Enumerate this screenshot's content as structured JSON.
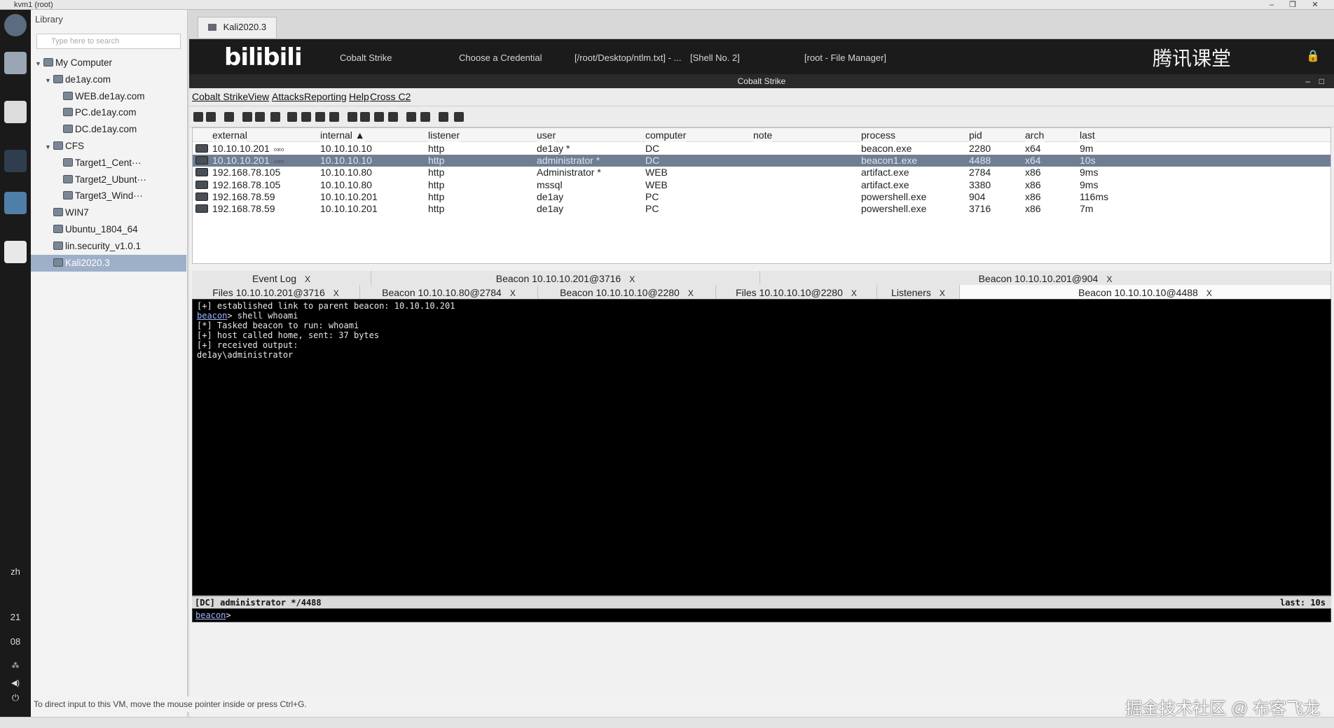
{
  "host": {
    "title": "kvm1 (root)",
    "status_text": "To direct input to this VM, move the mouse pointer inside or press Ctrl+G.",
    "watermark": "掘金技术社区 @ 布客飞龙"
  },
  "library": {
    "title": "Library",
    "search_placeholder": "Type here to search",
    "tree": [
      {
        "label": "My Computer",
        "indent": 0,
        "expanded": true
      },
      {
        "label": "de1ay.com",
        "indent": 1,
        "expanded": true
      },
      {
        "label": "WEB.de1ay.com",
        "indent": 2
      },
      {
        "label": "PC.de1ay.com",
        "indent": 2
      },
      {
        "label": "DC.de1ay.com",
        "indent": 2
      },
      {
        "label": "CFS",
        "indent": 1,
        "expanded": true
      },
      {
        "label": "Target1_Cent···",
        "indent": 2
      },
      {
        "label": "Target2_Ubunt···",
        "indent": 2
      },
      {
        "label": "Target3_Wind···",
        "indent": 2
      },
      {
        "label": "WIN7",
        "indent": 1
      },
      {
        "label": "Ubuntu_1804_64",
        "indent": 1
      },
      {
        "label": "lin.security_v1.0.1",
        "indent": 1
      },
      {
        "label": "Kali2020.3",
        "indent": 1,
        "selected": true
      }
    ]
  },
  "dock": {
    "lang": "zh",
    "time_hour": "21",
    "time_min": "08"
  },
  "guest": {
    "vm_tab": "Kali2020.3",
    "taskbar": {
      "logo_text": "bilibili",
      "logo_right": "腾讯课堂",
      "items": [
        "Cobalt Strike",
        "Choose a Credential",
        "[/root/Desktop/ntlm.txt] - ...",
        "[Shell No. 2]",
        "[root - File Manager]"
      ]
    },
    "app_title": "Cobalt Strike"
  },
  "menu": [
    "Cobalt Strike",
    "View",
    "Attacks",
    "Reporting",
    "Help",
    "Cross C2"
  ],
  "sessions": {
    "columns": [
      "external",
      "internal ▲",
      "listener",
      "user",
      "computer",
      "note",
      "process",
      "pid",
      "arch",
      "last"
    ],
    "rows": [
      {
        "external": "10.10.10.201",
        "link": "∞∞",
        "internal": "10.10.10.10",
        "listener": "http",
        "user": "de1ay *",
        "computer": "DC",
        "note": "",
        "process": "beacon.exe",
        "pid": "2280",
        "arch": "x64",
        "last": "9m"
      },
      {
        "external": "10.10.10.201",
        "link": "∞∞",
        "internal": "10.10.10.10",
        "listener": "http",
        "user": "administrator *",
        "computer": "DC",
        "note": "",
        "process": "beacon1.exe",
        "pid": "4488",
        "arch": "x64",
        "last": "10s",
        "selected": true
      },
      {
        "external": "192.168.78.105",
        "link": "",
        "internal": "10.10.10.80",
        "listener": "http",
        "user": "Administrator *",
        "computer": "WEB",
        "note": "",
        "process": "artifact.exe",
        "pid": "2784",
        "arch": "x86",
        "last": "9ms"
      },
      {
        "external": "192.168.78.105",
        "link": "",
        "internal": "10.10.10.80",
        "listener": "http",
        "user": "mssql",
        "computer": "WEB",
        "note": "",
        "process": "artifact.exe",
        "pid": "3380",
        "arch": "x86",
        "last": "9ms"
      },
      {
        "external": "192.168.78.59",
        "link": "",
        "internal": "10.10.10.201",
        "listener": "http",
        "user": "de1ay",
        "computer": "PC",
        "note": "",
        "process": "powershell.exe",
        "pid": "904",
        "arch": "x86",
        "last": "116ms"
      },
      {
        "external": "192.168.78.59",
        "link": "",
        "internal": "10.10.10.201",
        "listener": "http",
        "user": "de1ay",
        "computer": "PC",
        "note": "",
        "process": "powershell.exe",
        "pid": "3716",
        "arch": "x86",
        "last": "7m"
      }
    ]
  },
  "tabs_row1": [
    "Event Log",
    "Beacon 10.10.10.201@3716",
    "Beacon 10.10.10.201@904"
  ],
  "tabs_row2": [
    "Files 10.10.10.201@3716",
    "Beacon 10.10.10.80@2784",
    "Beacon 10.10.10.10@2280",
    "Files 10.10.10.10@2280",
    "Listeners",
    "Beacon 10.10.10.10@4488"
  ],
  "tab_close": "X",
  "console": {
    "lines": [
      {
        "text": "[+] established link to parent beacon: 10.10.10.201"
      },
      {
        "prompt": "beacon",
        "text": "> shell whoami"
      },
      {
        "text": "[*] Tasked beacon to run: whoami"
      },
      {
        "text": "[+] host called home, sent: 37 bytes"
      },
      {
        "text": "[+] received output:"
      },
      {
        "text": "de1ay\\administrator"
      }
    ],
    "status_left": "[DC] administrator */4488",
    "status_right": "last: 10s",
    "input_prompt": "beacon",
    "input_suffix": ">"
  }
}
